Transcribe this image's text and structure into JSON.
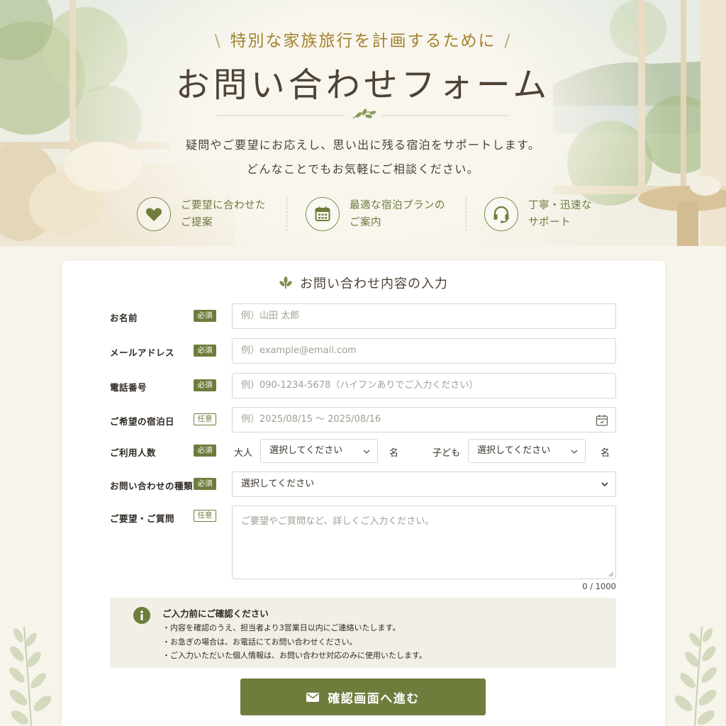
{
  "hero": {
    "kicker": "特別な家族旅行を計画するために",
    "title": "お問い合わせフォーム",
    "description_line1": "疑問やご要望にお応えし、思い出に残る宿泊をサポートします。",
    "description_line2": "どんなことでもお気軽にご相談ください。",
    "features": [
      {
        "icon": "heart-icon",
        "line1": "ご要望に合わせた",
        "line2": "ご提案"
      },
      {
        "icon": "calendar-icon",
        "line1": "最適な宿泊プランの",
        "line2": "ご案内"
      },
      {
        "icon": "headset-icon",
        "line1": "丁寧・迅速な",
        "line2": "サポート"
      }
    ]
  },
  "form": {
    "section_title": "お問い合わせ内容の入力",
    "required_label": "必須",
    "optional_label": "任意",
    "name": {
      "label": "お名前",
      "placeholder": "例）山田 太郎"
    },
    "email": {
      "label": "メールアドレス",
      "placeholder": "例）example@email.com"
    },
    "phone": {
      "label": "電話番号",
      "placeholder": "例）090-1234-5678（ハイフンありでご入力ください）"
    },
    "dates": {
      "label": "ご希望の宿泊日",
      "placeholder": "例）2025/08/15 ～ 2025/08/16"
    },
    "people": {
      "label": "ご利用人数",
      "adults_label": "大人",
      "adults_value": "選択してください",
      "children_label": "子ども",
      "children_value": "選択してください",
      "unit": "名"
    },
    "inquiry_type": {
      "label": "お問い合わせの種類",
      "value": "選択してください"
    },
    "message": {
      "label": "ご要望・ご質問",
      "placeholder": "ご要望やご質問など、詳しくご入力ください。",
      "counter": "0 / 1000"
    },
    "notice": {
      "title": "ご入力前にご確認ください",
      "items": [
        "内容を確認のうえ、担当者より3営業日以内にご連絡いたします。",
        "お急ぎの場合は、お電話にてお問い合わせください。",
        "ご入力いただいた個人情報は、お問い合わせ対応のみに使用いたします。"
      ]
    },
    "submit_label": "確認画面へ進む"
  },
  "colors": {
    "accent": "#6e7d3c",
    "gold": "#a48330",
    "background": "#f7f4ec"
  }
}
